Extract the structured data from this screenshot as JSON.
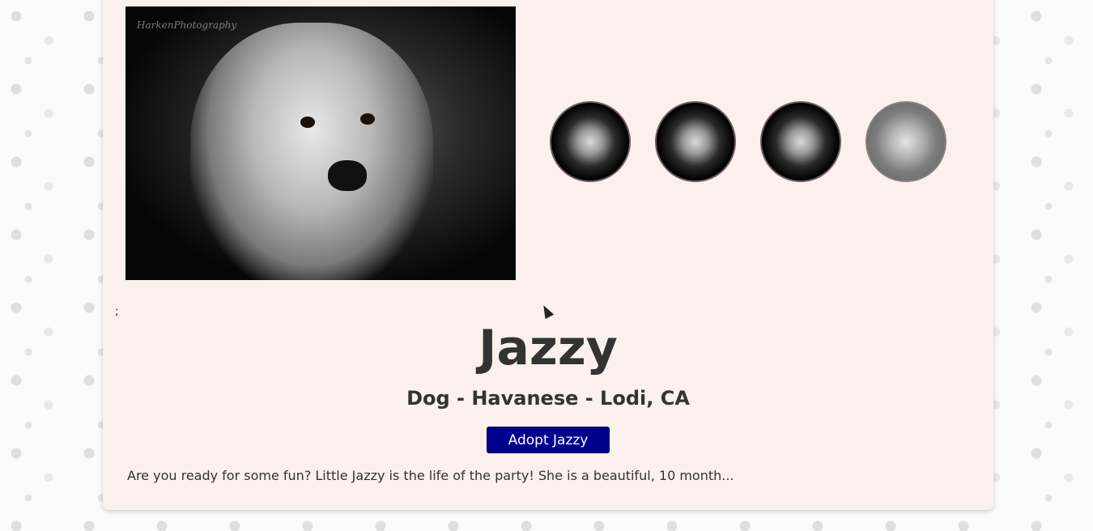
{
  "pet": {
    "name": "Jazzy",
    "subtitle": "Dog - Havanese - Lodi, CA",
    "adopt_label": "Adopt Jazzy",
    "description": "Are you ready for some fun? Little Jazzy is the life of the party! She is a beautiful, 10 month...",
    "stray_text": ";"
  },
  "gallery": {
    "main_photo_watermark": "HarkenPhotography",
    "thumbnails": [
      {
        "label": "photo-1",
        "active": false
      },
      {
        "label": "photo-2",
        "active": false
      },
      {
        "label": "photo-3",
        "active": false
      },
      {
        "label": "photo-4",
        "active": true
      }
    ]
  },
  "colors": {
    "card_background": "#fbf0ed",
    "adopt_button": "#00008b",
    "text": "#333333"
  }
}
